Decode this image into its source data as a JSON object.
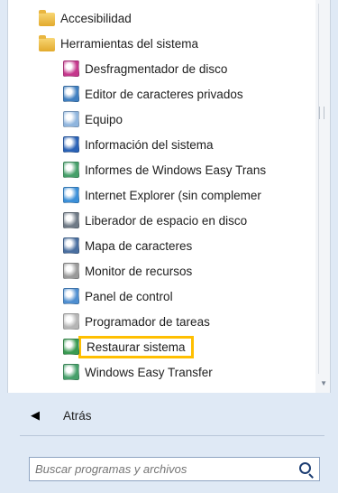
{
  "menu": {
    "items": [
      {
        "label": "Accesibilidad",
        "level": 0,
        "icon": "folder-icon",
        "color": "#e9b640"
      },
      {
        "label": "Herramientas del sistema",
        "level": 0,
        "icon": "folder-icon",
        "color": "#e9b640"
      },
      {
        "label": "Desfragmentador de disco",
        "level": 1,
        "icon": "disk-defragmenter-icon",
        "color": "#c5378c"
      },
      {
        "label": "Editor de caracteres privados",
        "level": 1,
        "icon": "private-character-editor-icon",
        "color": "#3f7fc0"
      },
      {
        "label": "Equipo",
        "level": 1,
        "icon": "computer-icon",
        "color": "#8fb5de"
      },
      {
        "label": "Información del sistema",
        "level": 1,
        "icon": "system-information-icon",
        "color": "#2a62b6"
      },
      {
        "label": "Informes de Windows Easy Trans",
        "level": 1,
        "icon": "easy-transfer-reports-icon",
        "color": "#46a06a"
      },
      {
        "label": "Internet Explorer (sin complemer",
        "level": 1,
        "icon": "internet-explorer-icon",
        "color": "#3b8fd8"
      },
      {
        "label": "Liberador de espacio en disco",
        "level": 1,
        "icon": "disk-cleanup-icon",
        "color": "#6f7a86"
      },
      {
        "label": "Mapa de caracteres",
        "level": 1,
        "icon": "character-map-icon",
        "color": "#4a6fa0"
      },
      {
        "label": "Monitor de recursos",
        "level": 1,
        "icon": "resource-monitor-icon",
        "color": "#9a9a9a"
      },
      {
        "label": "Panel de control",
        "level": 1,
        "icon": "control-panel-icon",
        "color": "#4e8ed0"
      },
      {
        "label": "Programador de tareas",
        "level": 1,
        "icon": "task-scheduler-icon",
        "color": "#b5b5b5"
      },
      {
        "label": "Restaurar sistema",
        "level": 1,
        "icon": "system-restore-icon",
        "color": "#3a9a52",
        "highlighted": true
      },
      {
        "label": "Windows Easy Transfer",
        "level": 1,
        "icon": "easy-transfer-icon",
        "color": "#46a06a"
      }
    ],
    "highlight_color": "#ffbf00"
  },
  "footer": {
    "back_label": "Atrás"
  },
  "search": {
    "placeholder": "Buscar programas y archivos"
  }
}
